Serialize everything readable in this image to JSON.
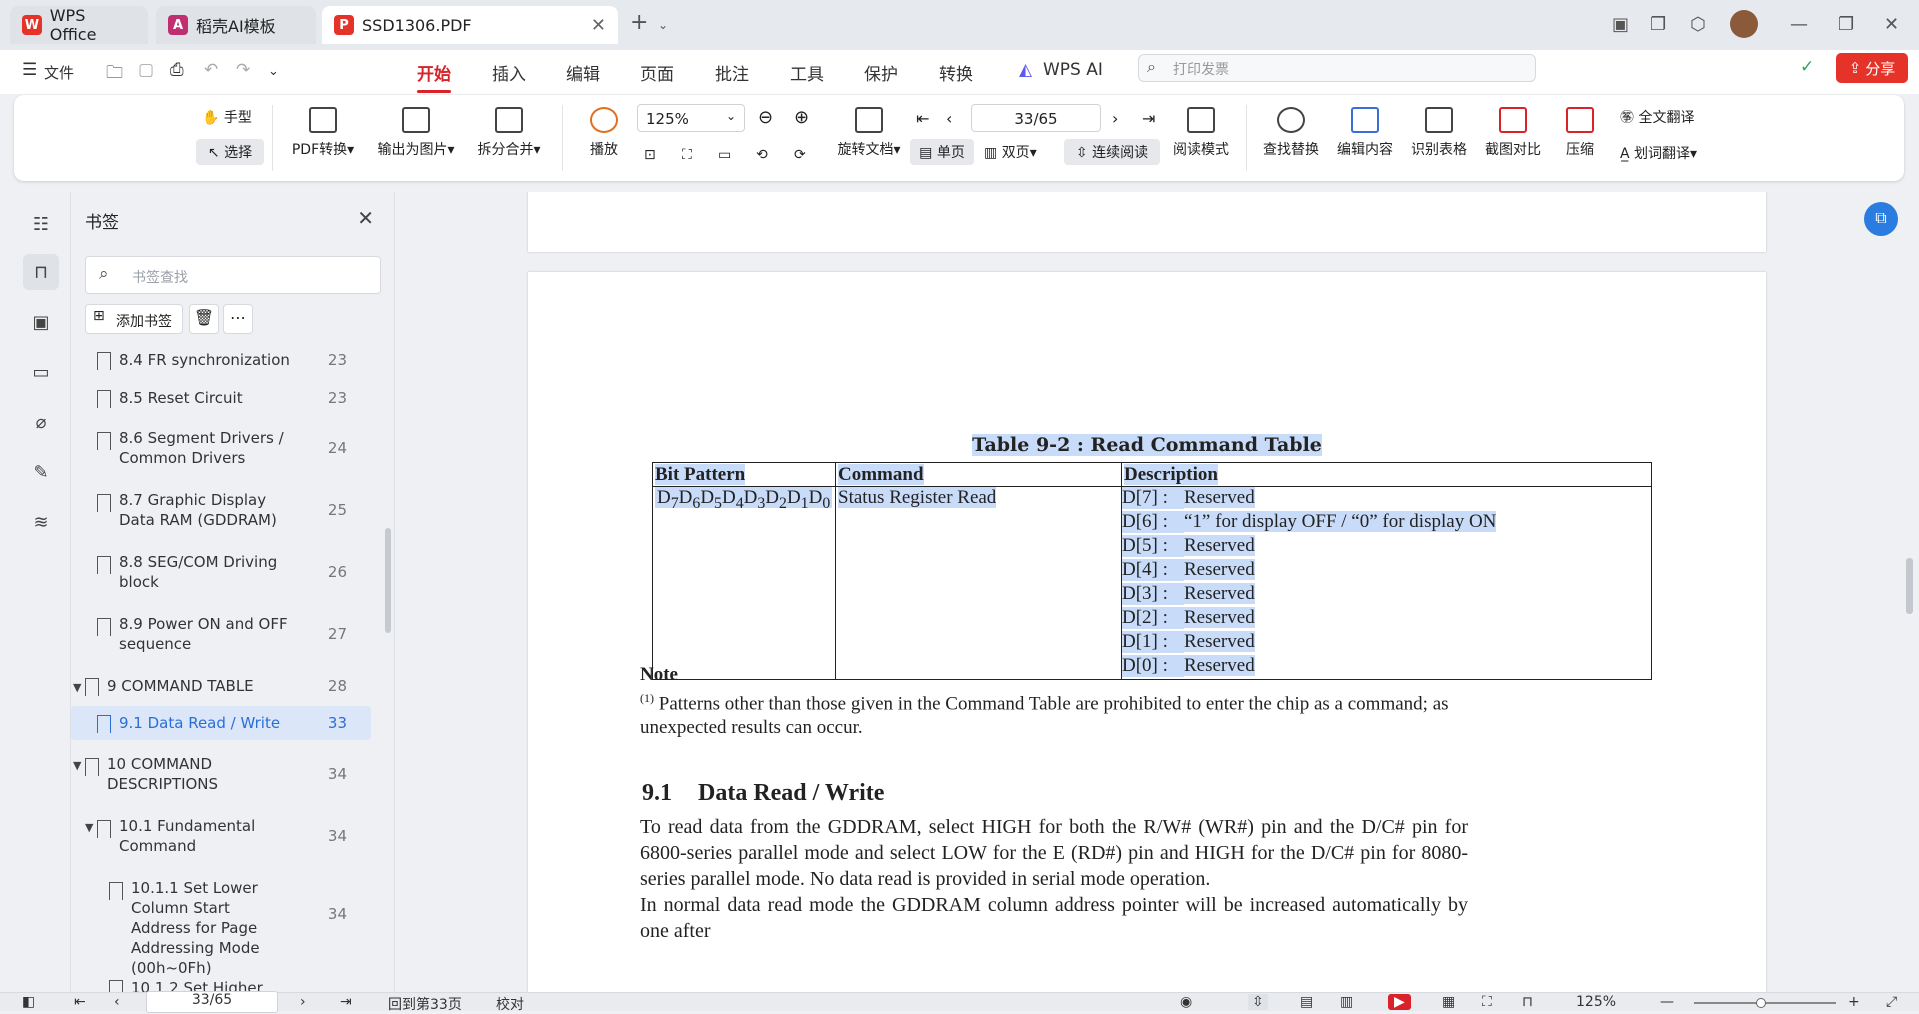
{
  "titlebar": {
    "tabs": [
      {
        "label": "WPS Office"
      },
      {
        "label": "稻壳AI模板"
      },
      {
        "label": "SSD1306.PDF"
      }
    ]
  },
  "menubar": {
    "file": "文件",
    "items": [
      "开始",
      "插入",
      "编辑",
      "页面",
      "批注",
      "工具",
      "保护",
      "转换"
    ],
    "wps_ai": "WPS AI",
    "search_placeholder": "打印发票",
    "share": "分享"
  },
  "toolbar": {
    "hand": "手型",
    "select": "选择",
    "pdf_convert": "PDF转换",
    "export_image": "输出为图片",
    "split_merge": "拆分合并",
    "play": "播放",
    "zoom": "125%",
    "page": "33/65",
    "rotate": "旋转文档",
    "single": "单页",
    "double": "双页",
    "continuous": "连续阅读",
    "read_mode": "阅读模式",
    "find_replace": "查找替换",
    "edit_content": "编辑内容",
    "recognize_table": "识别表格",
    "screenshot_compare": "截图对比",
    "compress": "压缩",
    "full_translate": "全文翻译",
    "word_translate": "划词翻译"
  },
  "bookmarks": {
    "title": "书签",
    "search_placeholder": "书签查找",
    "add": "添加书签",
    "items": [
      {
        "label": "8.4  FR synchronization",
        "page": "23"
      },
      {
        "label": "8.5 Reset Circuit",
        "page": "23"
      },
      {
        "label": "8.6 Segment Drivers / Common Drivers",
        "page": "24"
      },
      {
        "label": "8.7 Graphic Display Data RAM (GDDRAM)",
        "page": "25"
      },
      {
        "label": "8.8 SEG/COM Driving block",
        "page": "26"
      },
      {
        "label": "8.9  Power ON and OFF sequence",
        "page": "27"
      },
      {
        "label": "9 COMMAND TABLE",
        "page": "28"
      },
      {
        "label": "9.1 Data Read / Write",
        "page": "33"
      },
      {
        "label": "10  COMMAND DESCRIPTIONS",
        "page": "34"
      },
      {
        "label": "10.1 Fundamental Command",
        "page": "34"
      },
      {
        "label": "10.1.1 Set Lower Column Start Address for Page Addressing Mode (00h~0Fh)",
        "page": "34"
      },
      {
        "label": "10.1.2 Set Higher",
        "page": ""
      }
    ]
  },
  "document": {
    "table_title": "Table 9-2 : Read Command Table",
    "headers": [
      "Bit Pattern",
      "Command",
      "Description"
    ],
    "bit_pattern": "D7D6D5D4D3D2D1D0",
    "command": "Status Register Read",
    "descriptions": [
      {
        "bit": "D[7] :",
        "text": "Reserved"
      },
      {
        "bit": "D[6] :",
        "text": "“1” for display OFF / “0” for display ON"
      },
      {
        "bit": "D[5] :",
        "text": "Reserved"
      },
      {
        "bit": "D[4] :",
        "text": "Reserved"
      },
      {
        "bit": "D[3] :",
        "text": "Reserved"
      },
      {
        "bit": "D[2] :",
        "text": "Reserved"
      },
      {
        "bit": "D[1] :",
        "text": "Reserved"
      },
      {
        "bit": "D[0] :",
        "text": "Reserved"
      }
    ],
    "note_title": "Note",
    "note_mark": "(1)",
    "note_text": "Patterns other than those given in the Command Table are prohibited to enter the chip as a command; as unexpected results can occur.",
    "section_num": "9.1",
    "section_title": "Data Read / Write",
    "paragraph1": "To read data from the GDDRAM, select HIGH for both the R/W# (WR#) pin and the D/C# pin for 6800-series parallel mode and select LOW for the E (RD#) pin and HIGH for the D/C# pin for 8080-series parallel mode. No data read is provided in serial mode operation.",
    "paragraph2": "In normal data read mode the GDDRAM column address pointer will be increased automatically by one after"
  },
  "statusbar": {
    "page": "33/65",
    "back": "回到第33页",
    "proof": "校对",
    "zoom": "125%"
  },
  "colors": {
    "accent": "#d8232a",
    "highlight": "#c8dcfa",
    "selection": "#2a6fd6"
  }
}
